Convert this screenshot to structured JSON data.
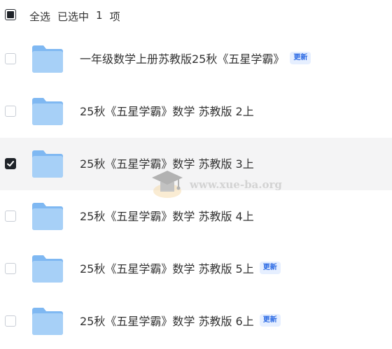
{
  "header": {
    "select_all": "全选",
    "selected_prefix": "已选中",
    "selected_count": "1",
    "selected_suffix": "项"
  },
  "items": [
    {
      "name": "一年级数学上册苏教版25秋《五星学霸》",
      "badge": "更新",
      "checked": false
    },
    {
      "name": "25秋《五星学霸》数学 苏教版 2上",
      "badge": "",
      "checked": false
    },
    {
      "name": "25秋《五星学霸》数学 苏教版 3上",
      "badge": "",
      "checked": true
    },
    {
      "name": "25秋《五星学霸》数学 苏教版 4上",
      "badge": "",
      "checked": false
    },
    {
      "name": "25秋《五星学霸》数学 苏教版 5上",
      "badge": "更新",
      "checked": false
    },
    {
      "name": "25秋《五星学霸》数学 苏教版 6上",
      "badge": "更新",
      "checked": false
    }
  ],
  "watermark": {
    "text": "www.xue-ba.org"
  },
  "colors": {
    "folder_back": "#7fb8f2",
    "folder_front": "#a7d0f7",
    "badge_text": "#2d6be4",
    "badge_bg": "#e6efff",
    "selected_row_bg": "#f4f4f5"
  },
  "icons": {
    "folder": "folder-icon",
    "checkbox": "checkbox-icon",
    "watermark_logo": "graduation-cap-icon"
  }
}
